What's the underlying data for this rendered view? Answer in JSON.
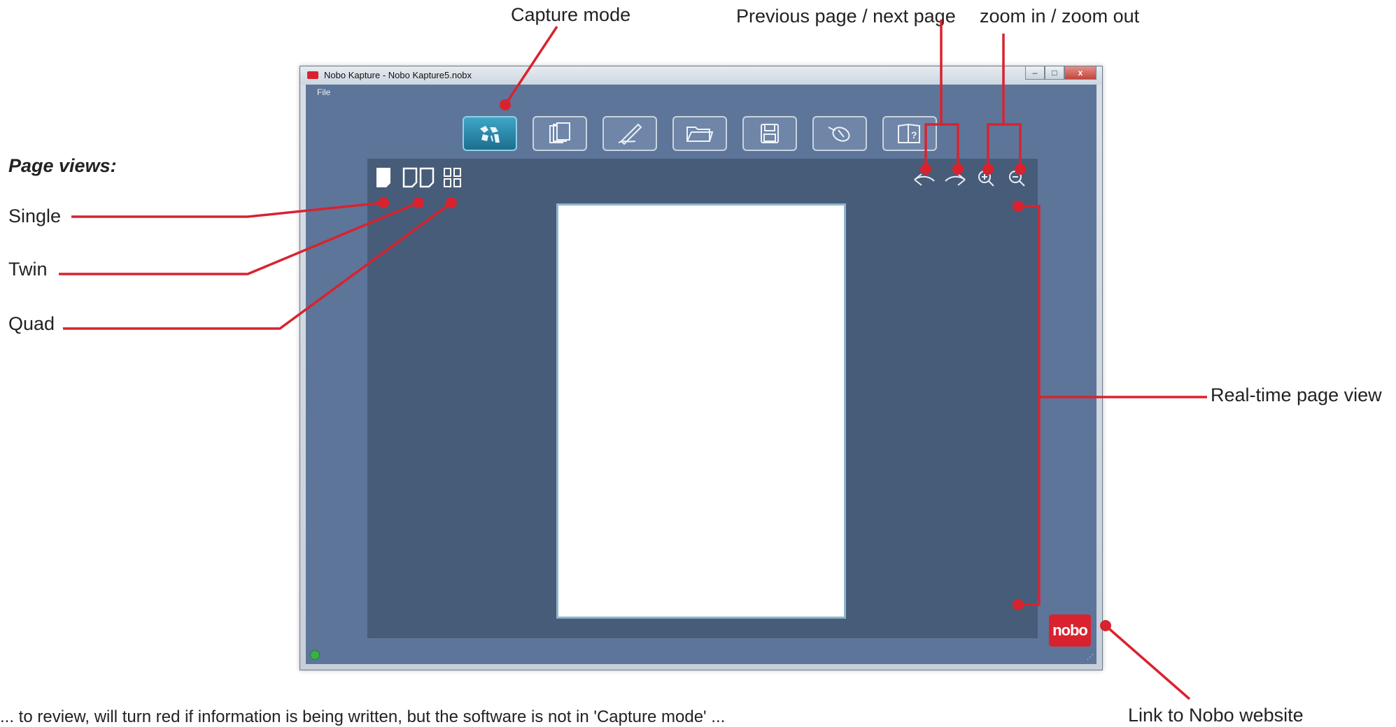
{
  "callouts": {
    "capture_mode": "Capture mode",
    "prev_next": "Previous page / next page",
    "zoom": "zoom in / zoom out",
    "page_views_heading": "Page views:",
    "single": "Single",
    "twin": "Twin",
    "quad": "Quad",
    "realtime": "Real-time page view",
    "nobo_website": "Link to Nobo website"
  },
  "footnote": "... to review, will turn red if information is being written, but the software is not in 'Capture mode' ...",
  "window": {
    "title": "Nobo Kapture - Nobo Kapture5.nobx",
    "controls": {
      "minimize": "–",
      "maximize": "□",
      "close": "x"
    },
    "menu": {
      "file": "File"
    }
  },
  "toolbar": {
    "buttons": [
      {
        "icon": "capture-mode-icon",
        "active": true
      },
      {
        "icon": "pages-icon",
        "active": false
      },
      {
        "icon": "pen-icon",
        "active": false
      },
      {
        "icon": "folder-icon",
        "active": false
      },
      {
        "icon": "save-icon",
        "active": false
      },
      {
        "icon": "mouse-icon",
        "active": false
      },
      {
        "icon": "help-book-icon",
        "active": false
      }
    ]
  },
  "logo": {
    "text": "nobo"
  },
  "colors": {
    "annotation": "#d8232f",
    "window_bg": "#5d7599",
    "workspace_bg": "#475c78",
    "toolbar_active": "#2a88ab"
  }
}
